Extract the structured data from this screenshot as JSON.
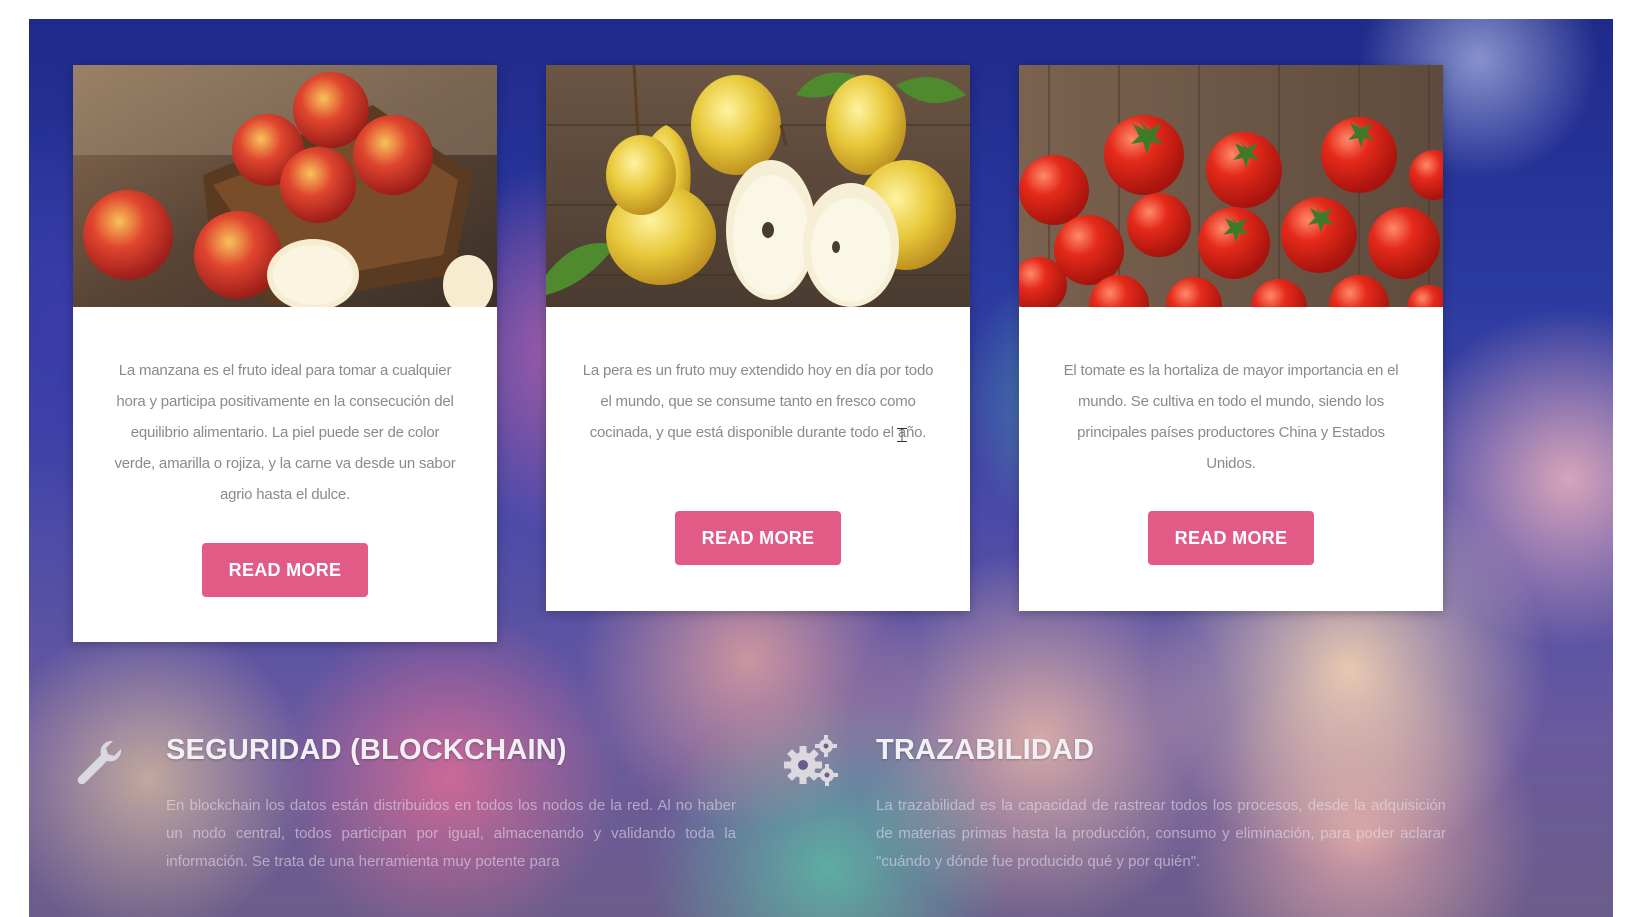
{
  "cards": [
    {
      "image": "apples-in-crate-image",
      "text": "La manzana es el fruto ideal para tomar a cualquier hora y participa positivamente en la consecución del equilibrio alimentario. La piel puede ser de color verde, amarilla o rojiza, y la carne va desde un sabor agrio hasta el dulce.",
      "button": "READ MORE"
    },
    {
      "image": "pears-image",
      "text": "La pera es un fruto muy extendido hoy en día por todo el mundo, que se consume tanto en fresco como cocinada, y que está disponible durante todo el año.",
      "button": "READ MORE"
    },
    {
      "image": "tomatoes-image",
      "text": "El tomate es la hortaliza de mayor importancia en el mundo. Se cultiva en todo el mundo, siendo los principales países productores China y Estados Unidos.",
      "button": "READ MORE"
    }
  ],
  "features": [
    {
      "icon": "wrench-icon",
      "title": "SEGURIDAD (BLOCKCHAIN)",
      "text": "En blockchain los datos están distribuidos en todos los nodos de la red. Al no haber un nodo central, todos participan por igual, almacenando y validando toda la información. Se trata de una herramienta muy potente para"
    },
    {
      "icon": "gears-icon",
      "title": "TRAZABILIDAD",
      "text": "La trazabilidad es la capacidad de rastrear todos los procesos, desde la adquisición de materias primas hasta la producción, consumo y eliminación, para poder aclarar \"cuándo y dónde fue producido qué y por quién\"."
    }
  ],
  "colors": {
    "button": "#e25a86",
    "title": "#f2f0f4"
  }
}
